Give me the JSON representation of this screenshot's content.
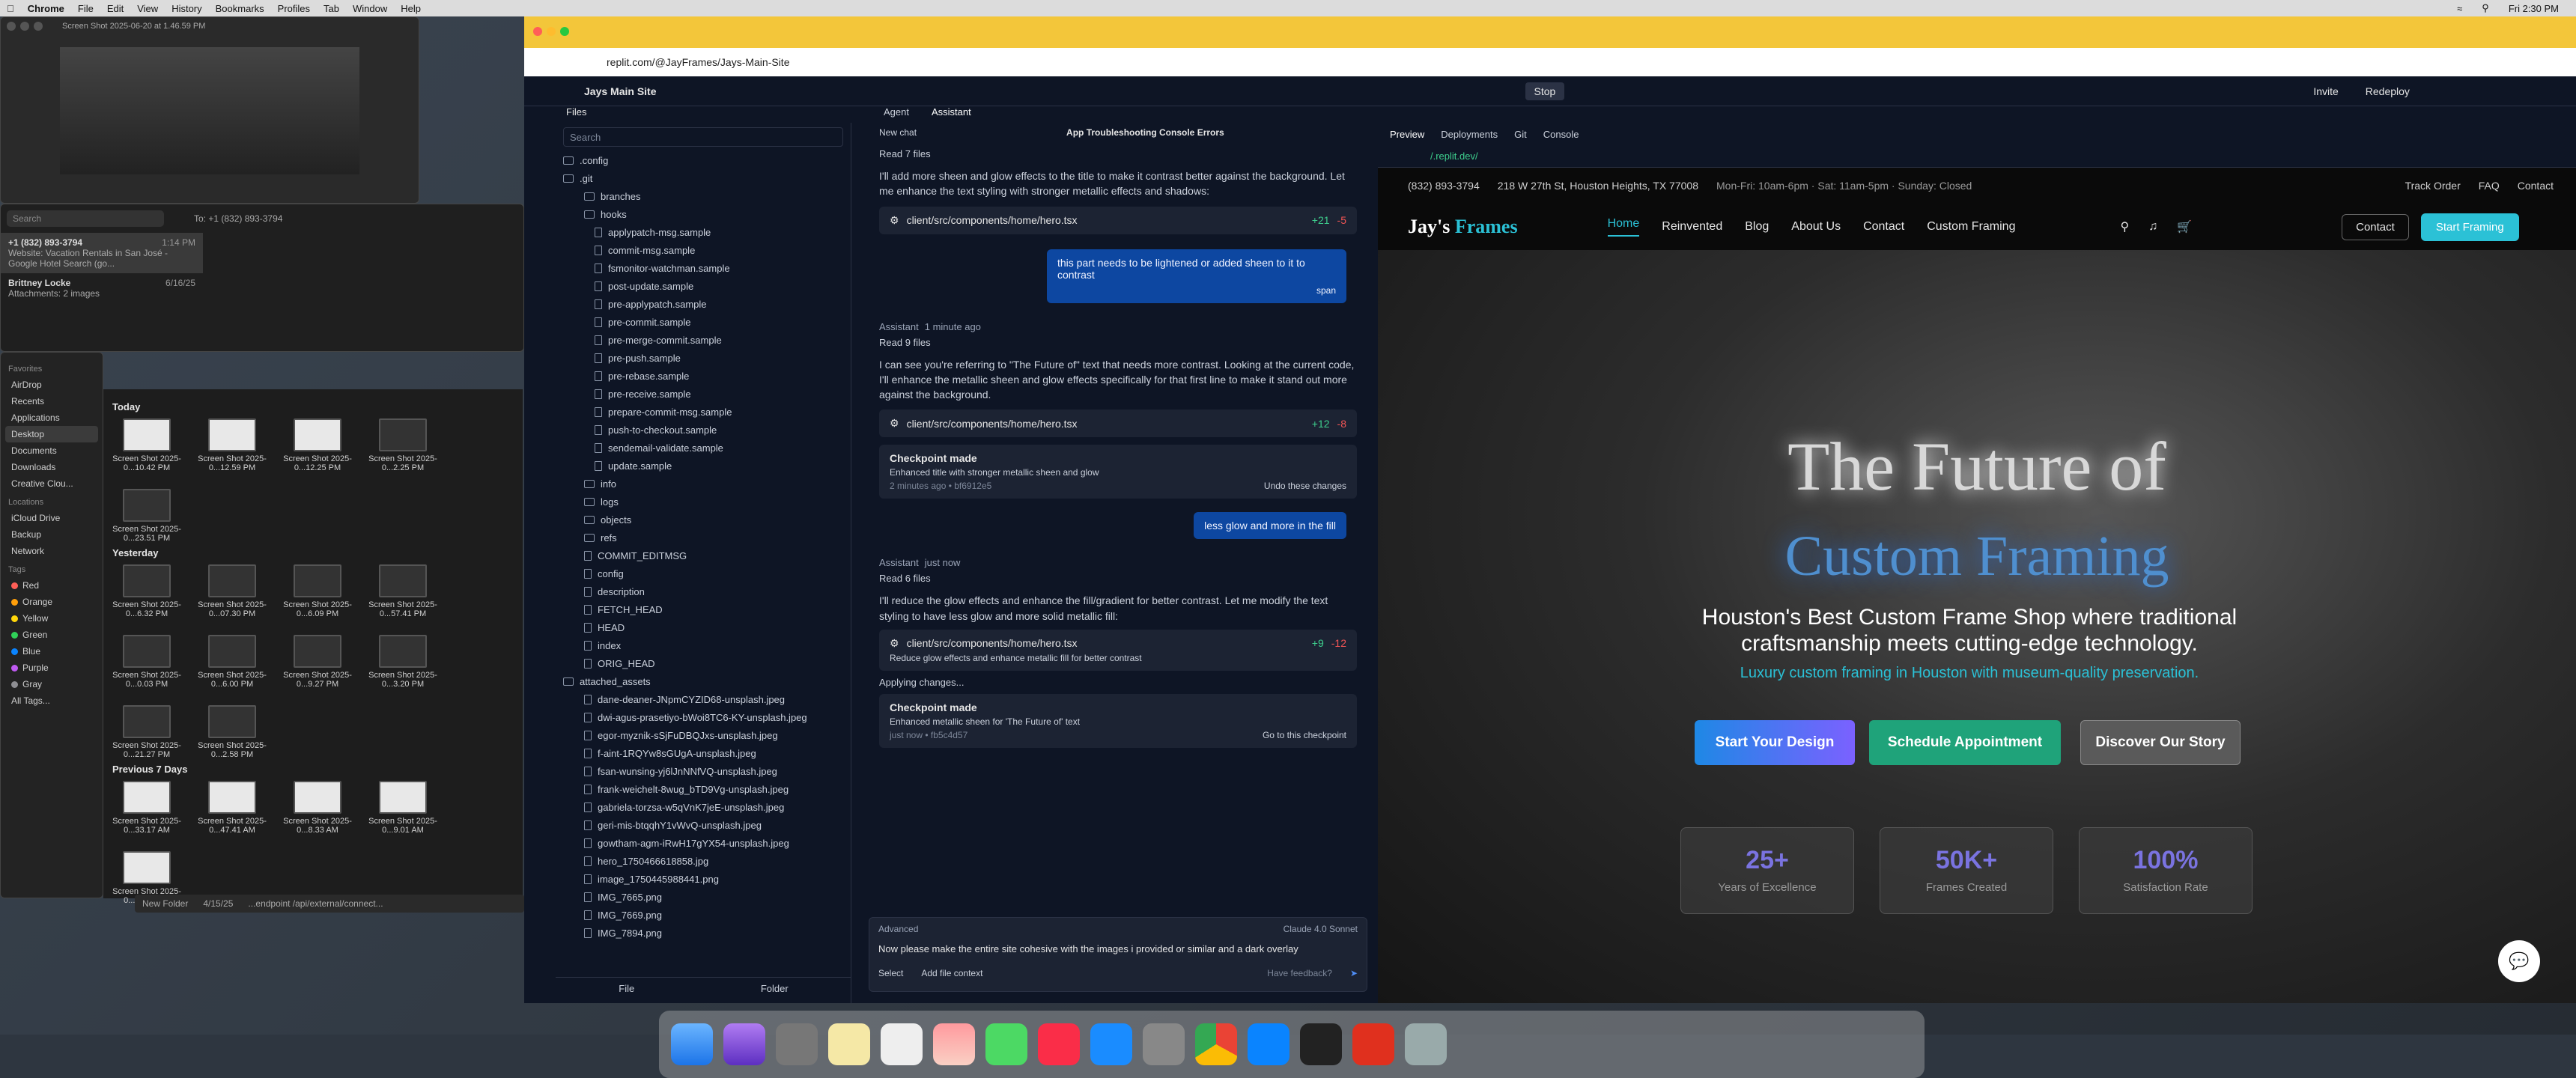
{
  "menubar": {
    "app_name": "Chrome",
    "items": [
      "File",
      "Edit",
      "View",
      "History",
      "Bookmarks",
      "Profiles",
      "Tab",
      "Window",
      "Help"
    ],
    "clock": "Fri 2:30 PM"
  },
  "screenshot_window": {
    "title": "Screen Shot 2025-06-20 at 1.46.59 PM"
  },
  "messages": {
    "search_placeholder": "Search",
    "to_label": "To: +1 (832) 893-3794",
    "conversations": [
      {
        "name": "+1 (832) 893-3794",
        "time": "1:14 PM",
        "snippet": "Website: Vacation Rentals in San José - Google Hotel Search (go..."
      },
      {
        "name": "Brittney Locke",
        "time": "6/16/25",
        "snippet": "Attachments: 2 images"
      }
    ]
  },
  "finder": {
    "title": "Desktop",
    "favorites_label": "Favorites",
    "favorites": [
      "AirDrop",
      "Recents",
      "Applications",
      "Desktop",
      "Documents",
      "Downloads",
      "Creative Clou..."
    ],
    "locations_label": "Locations",
    "locations": [
      "iCloud Drive",
      "Backup",
      "Network"
    ],
    "tags_label": "Tags",
    "tags": [
      {
        "name": "Red",
        "color": "#ff5f57"
      },
      {
        "name": "Orange",
        "color": "#ff9f0a"
      },
      {
        "name": "Yellow",
        "color": "#ffd60a"
      },
      {
        "name": "Green",
        "color": "#30d158"
      },
      {
        "name": "Blue",
        "color": "#0a84ff"
      },
      {
        "name": "Purple",
        "color": "#bf5af2"
      },
      {
        "name": "Gray",
        "color": "#8e8e93"
      },
      {
        "name": "All Tags...",
        "color": ""
      }
    ],
    "sections": [
      {
        "label": "Today",
        "items": [
          "Screen Shot 2025-0...10.42 PM",
          "Screen Shot 2025-0...12.59 PM",
          "Screen Shot 2025-0...12.25 PM",
          "Screen Shot 2025-0...2.25 PM",
          "Screen Shot 2025-0...23.51 PM"
        ]
      },
      {
        "label": "Yesterday",
        "items": [
          "Screen Shot 2025-0...6.32 PM",
          "Screen Shot 2025-0...07.30 PM",
          "Screen Shot 2025-0...6.09 PM",
          "Screen Shot 2025-0...57.41 PM",
          "Screen Shot 2025-0...0.03 PM",
          "Screen Shot 2025-0...6.00 PM",
          "Screen Shot 2025-0...9.27 PM",
          "Screen Shot 2025-0...3.20 PM",
          "Screen Shot 2025-0...21.27 PM",
          "Screen Shot 2025-0...2.58 PM"
        ]
      },
      {
        "label": "Previous 7 Days",
        "items": [
          "Screen Shot 2025-0...33.17 AM",
          "Screen Shot 2025-0...47.41 AM",
          "Screen Shot 2025-0...8.33 AM",
          "Screen Shot 2025-0...9.01 AM",
          "Screen Shot 2025-0...51.01 AM"
        ]
      }
    ],
    "footer_item": "New Folder",
    "footer_date": "4/15/25",
    "footer_path": "...endpoint /api/external/connect..."
  },
  "browser": {
    "url": "replit.com/@JayFrames/Jays-Main-Site"
  },
  "replit": {
    "project": "Jays Main Site",
    "stop_label": "Stop",
    "invite_label": "Invite",
    "redeploy_label": "Redeploy",
    "files_label": "Files",
    "search_placeholder": "Search",
    "file_tree": [
      {
        "name": ".config",
        "level": 1,
        "type": "folder"
      },
      {
        "name": ".git",
        "level": 1,
        "type": "folder"
      },
      {
        "name": "branches",
        "level": 2,
        "type": "folder"
      },
      {
        "name": "hooks",
        "level": 2,
        "type": "folder"
      },
      {
        "name": "applypatch-msg.sample",
        "level": 3,
        "type": "file"
      },
      {
        "name": "commit-msg.sample",
        "level": 3,
        "type": "file"
      },
      {
        "name": "fsmonitor-watchman.sample",
        "level": 3,
        "type": "file"
      },
      {
        "name": "post-update.sample",
        "level": 3,
        "type": "file"
      },
      {
        "name": "pre-applypatch.sample",
        "level": 3,
        "type": "file"
      },
      {
        "name": "pre-commit.sample",
        "level": 3,
        "type": "file"
      },
      {
        "name": "pre-merge-commit.sample",
        "level": 3,
        "type": "file"
      },
      {
        "name": "pre-push.sample",
        "level": 3,
        "type": "file"
      },
      {
        "name": "pre-rebase.sample",
        "level": 3,
        "type": "file"
      },
      {
        "name": "pre-receive.sample",
        "level": 3,
        "type": "file"
      },
      {
        "name": "prepare-commit-msg.sample",
        "level": 3,
        "type": "file"
      },
      {
        "name": "push-to-checkout.sample",
        "level": 3,
        "type": "file"
      },
      {
        "name": "sendemail-validate.sample",
        "level": 3,
        "type": "file"
      },
      {
        "name": "update.sample",
        "level": 3,
        "type": "file"
      },
      {
        "name": "info",
        "level": 2,
        "type": "folder"
      },
      {
        "name": "logs",
        "level": 2,
        "type": "folder"
      },
      {
        "name": "objects",
        "level": 2,
        "type": "folder"
      },
      {
        "name": "refs",
        "level": 2,
        "type": "folder"
      },
      {
        "name": "COMMIT_EDITMSG",
        "level": 2,
        "type": "file"
      },
      {
        "name": "config",
        "level": 2,
        "type": "file"
      },
      {
        "name": "description",
        "level": 2,
        "type": "file"
      },
      {
        "name": "FETCH_HEAD",
        "level": 2,
        "type": "file"
      },
      {
        "name": "HEAD",
        "level": 2,
        "type": "file"
      },
      {
        "name": "index",
        "level": 2,
        "type": "file"
      },
      {
        "name": "ORIG_HEAD",
        "level": 2,
        "type": "file"
      },
      {
        "name": "attached_assets",
        "level": 1,
        "type": "folder"
      },
      {
        "name": "dane-deaner-JNpmCYZID68-unsplash.jpeg",
        "level": 2,
        "type": "file"
      },
      {
        "name": "dwi-agus-prasetiyo-bWoi8TC6-KY-unsplash.jpeg",
        "level": 2,
        "type": "file"
      },
      {
        "name": "egor-myznik-sSjFuDBQJxs-unsplash.jpeg",
        "level": 2,
        "type": "file"
      },
      {
        "name": "f-aint-1RQYw8sGUgA-unsplash.jpeg",
        "level": 2,
        "type": "file"
      },
      {
        "name": "fsan-wunsing-yj6lJnNNfVQ-unsplash.jpeg",
        "level": 2,
        "type": "file"
      },
      {
        "name": "frank-weichelt-8wug_bTD9Vg-unsplash.jpeg",
        "level": 2,
        "type": "file"
      },
      {
        "name": "gabriela-torzsa-w5qVnK7jeE-unsplash.jpeg",
        "level": 2,
        "type": "file"
      },
      {
        "name": "geri-mis-btqqhY1vWvQ-unsplash.jpeg",
        "level": 2,
        "type": "file"
      },
      {
        "name": "gowtham-agm-iRwH17gYX54-unsplash.jpeg",
        "level": 2,
        "type": "file"
      },
      {
        "name": "hero_1750466618858.jpg",
        "level": 2,
        "type": "file"
      },
      {
        "name": "image_1750445988441.png",
        "level": 2,
        "type": "file"
      },
      {
        "name": "IMG_7665.png",
        "level": 2,
        "type": "file"
      },
      {
        "name": "IMG_7669.png",
        "level": 2,
        "type": "file"
      },
      {
        "name": "IMG_7894.png",
        "level": 2,
        "type": "file"
      }
    ],
    "file_footer": [
      "File",
      "Folder"
    ],
    "tabs": [
      "Agent",
      "Assistant"
    ],
    "new_chat": "New chat",
    "chat_title": "App Troubleshooting Console Errors",
    "chat": {
      "read7": "Read 7 files",
      "msg1": "I'll add more sheen and glow effects to the title to make it contrast better against the background. Let me enhance the text styling with stronger metallic effects and shadows:",
      "file1": {
        "path": "client/src/components/home/hero.tsx",
        "plus": "+21",
        "minus": "-5"
      },
      "user1": "this part needs to be lightened or added sheen to it to contrast",
      "user1_tag": "span",
      "assistant_label": "Assistant",
      "time1": "1 minute ago",
      "read9": "Read 9 files",
      "msg2": "I can see you're referring to \"The Future of\" text that needs more contrast. Looking at the current code, I'll enhance the metallic sheen and glow effects specifically for that first line to make it stand out more against the background.",
      "file2": {
        "path": "client/src/components/home/hero.tsx",
        "plus": "+12",
        "minus": "-8"
      },
      "checkpoint1": {
        "title": "Checkpoint made",
        "desc": "Enhanced title with stronger metallic sheen and glow",
        "meta": "2 minutes ago • bf6912e5",
        "action": "Undo these changes"
      },
      "user2": "less glow and more in the fill",
      "time2": "just now",
      "read6": "Read 6 files",
      "msg3": "I'll reduce the glow effects and enhance the fill/gradient for better contrast. Let me modify the text styling to have less glow and more solid metallic fill:",
      "file3": {
        "path": "client/src/components/home/hero.tsx",
        "plus": "+9",
        "minus": "-12",
        "desc": "Reduce glow effects and enhance metallic fill for better contrast"
      },
      "applying": "Applying changes...",
      "checkpoint2": {
        "title": "Checkpoint made",
        "desc": "Enhanced metallic sheen for 'The Future of' text",
        "meta": "just now • fb5c4d57",
        "action": "Go to this checkpoint"
      }
    },
    "composer": {
      "advanced": "Advanced",
      "model": "Claude 4.0 Sonnet",
      "text": "Now please make the entire site cohesive with the images i provided or similar and a dark overlay",
      "select": "Select",
      "add_context": "Add file context",
      "feedback": "Have feedback?"
    },
    "pane_tabs": [
      "Preview",
      "Deployments",
      "Git",
      "Console"
    ],
    "preview_url": "/.replit.dev/"
  },
  "site": {
    "phone": "(832) 893-3794",
    "address": "218 W 27th St, Houston Heights, TX 77008",
    "hours": "Mon-Fri: 10am-6pm · Sat: 11am-5pm · Sunday: Closed",
    "top_links": [
      "Track Order",
      "FAQ",
      "Contact"
    ],
    "brand_a": "Jay's",
    "brand_b": "Frames",
    "nav": [
      "Home",
      "Reinvented",
      "Blog",
      "About Us",
      "Contact",
      "Custom Framing"
    ],
    "contact_btn": "Contact",
    "start_btn": "Start Framing",
    "hero_line1": "The Future of",
    "hero_line2": "Custom Framing",
    "subtitle": "Houston's Best Custom Frame Shop where traditional craftsmanship meets cutting-edge technology.",
    "tagline": "Luxury custom framing in Houston with museum-quality preservation.",
    "cta1": "Start Your Design",
    "cta2": "Schedule Appointment",
    "cta3": "Discover Our Story",
    "stats": [
      {
        "value": "25+",
        "label": "Years of Excellence"
      },
      {
        "value": "50K+",
        "label": "Frames Created"
      },
      {
        "value": "100%",
        "label": "Satisfaction Rate"
      }
    ]
  },
  "colors": {
    "accent": "#2bc1d6",
    "nav_active": "#2bc1d6",
    "stats": "#7a73e0",
    "cta_blue": "#1e88e5",
    "cta_green": "#1fa37a"
  }
}
